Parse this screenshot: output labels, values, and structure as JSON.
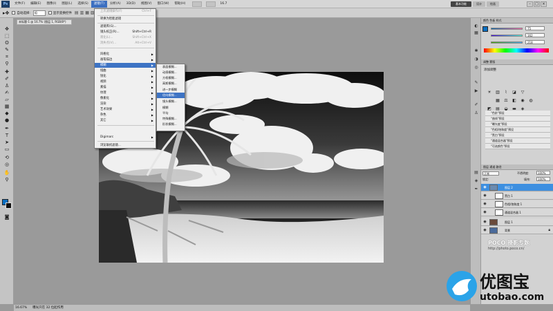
{
  "app": {
    "logo": "Ps"
  },
  "menubar": {
    "items": [
      "文件(F)",
      "编辑(E)",
      "图像(I)",
      "图层(L)",
      "选择(S)",
      "滤镜(T)",
      "分析(A)",
      "3D(D)",
      "视图(V)",
      "窗口(W)",
      "帮助(H)"
    ],
    "active_index": 5,
    "zoom": "16.7",
    "workspace_basic": "基本功能",
    "workspace_design": "设计",
    "workspace_paint": "绘画"
  },
  "options": {
    "auto_select_label": "自动选择:",
    "auto_select_value": "组",
    "show_transform_label": "显示变换控件"
  },
  "document": {
    "tab_title": "未标题-1 @ 16.7% (图层 1, RGB/8*)"
  },
  "filter_menu": {
    "items": [
      {
        "label": "上次滤镜操作(F)",
        "shortcut": "Ctrl+F",
        "disabled": true
      },
      {
        "label": "转换为智能滤镜",
        "disabled": false
      },
      {
        "label": "滤镜库(G)...",
        "disabled": false
      },
      {
        "label": "镜头校正(R)...",
        "shortcut": "Shift+Ctrl+R",
        "disabled": false
      },
      {
        "label": "液化(L)...",
        "shortcut": "Shift+Ctrl+X",
        "disabled": true
      },
      {
        "label": "消失点(V)...",
        "shortcut": "Alt+Ctrl+V",
        "disabled": true
      },
      {
        "label": "风格化",
        "submenu": true
      },
      {
        "label": "画笔描边",
        "submenu": true
      },
      {
        "label": "模糊",
        "submenu": true,
        "highlighted": true
      },
      {
        "label": "扭曲",
        "submenu": true
      },
      {
        "label": "锐化",
        "submenu": true
      },
      {
        "label": "视频",
        "submenu": true
      },
      {
        "label": "素描",
        "submenu": true
      },
      {
        "label": "纹理",
        "submenu": true
      },
      {
        "label": "像素化",
        "submenu": true
      },
      {
        "label": "渲染",
        "submenu": true
      },
      {
        "label": "艺术效果",
        "submenu": true
      },
      {
        "label": "杂色",
        "submenu": true
      },
      {
        "label": "其它",
        "submenu": true
      },
      {
        "label": "Digimarc",
        "submenu": true
      },
      {
        "label": "浏览联机滤镜..."
      }
    ],
    "blur_submenu": [
      "表面模糊...",
      "动感模糊...",
      "方框模糊...",
      "高斯模糊...",
      "进一步模糊",
      "径向模糊...",
      "镜头模糊...",
      "模糊",
      "平均",
      "特殊模糊...",
      "形状模糊..."
    ],
    "blur_highlight_index": 5
  },
  "panels": {
    "color": {
      "r": "75",
      "g": "162",
      "b": "218"
    },
    "adjust_tabs": "调整  蒙版",
    "adjust_title": "添加调整",
    "presets": [
      "\"色阶\"预设",
      "\"曲线\"预设",
      "\"曝光度\"预设",
      "\"色相/饱和度\"预设",
      "\"黑白\"预设",
      "\"通道混合器\"预设",
      "\"可选颜色\"预设"
    ],
    "layer_tabs": "图层  通道  路径",
    "blend_mode": "正常",
    "opacity_label": "不透明度:",
    "opacity": "100%",
    "fill_label": "填充:",
    "fill": "100%",
    "lock_label": "锁定:",
    "layers": [
      {
        "name": "图层 2",
        "selected": true
      },
      {
        "name": "黑白 1",
        "selected": false
      },
      {
        "name": "色相/饱和度 1",
        "selected": false
      },
      {
        "name": "通道混合器 1",
        "selected": false
      },
      {
        "name": "图层 1",
        "selected": false
      },
      {
        "name": "背景",
        "selected": false
      }
    ]
  },
  "watermark": {
    "poco": "POCO 摄影专题",
    "poco_url": "http://photo.poco.cn/",
    "brand_cn": "优图宝",
    "brand_en": "utobao.com"
  },
  "status": {
    "zoom": "16.67%",
    "doc": "曝光只在 32 位起作用"
  },
  "colors": {
    "accent": "#3d73c4",
    "foreground": "#0a6fc2",
    "background": "#111111"
  }
}
